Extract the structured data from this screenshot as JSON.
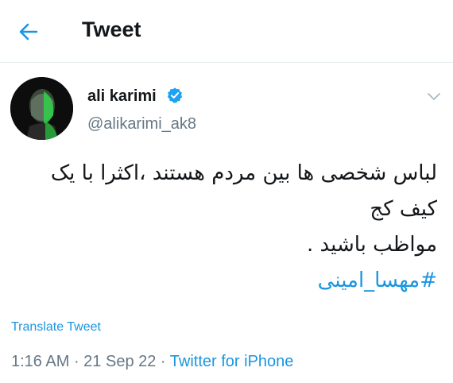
{
  "header": {
    "title": "Tweet",
    "back_icon": "arrow-left-icon"
  },
  "author": {
    "display_name": "ali karimi",
    "handle": "@alikarimi_ak8",
    "verified": true,
    "verified_icon": "verified-badge-icon",
    "menu_icon": "chevron-down-icon"
  },
  "tweet": {
    "lines": [
      "لباس شخصی ها بین مردم هستند ،اکثرا با یک",
      "کیف کج",
      "مواظب باشید ."
    ],
    "hashtag": "#مهسا_امینی"
  },
  "translate_label": "Translate Tweet",
  "meta": {
    "time": "1:16 AM",
    "separator": " · ",
    "date": "21 Sep 22",
    "source": "Twitter for iPhone"
  },
  "colors": {
    "accent": "#1b95e0",
    "text": "#14171a",
    "secondary": "#657786",
    "divider": "#e6ecf0"
  }
}
